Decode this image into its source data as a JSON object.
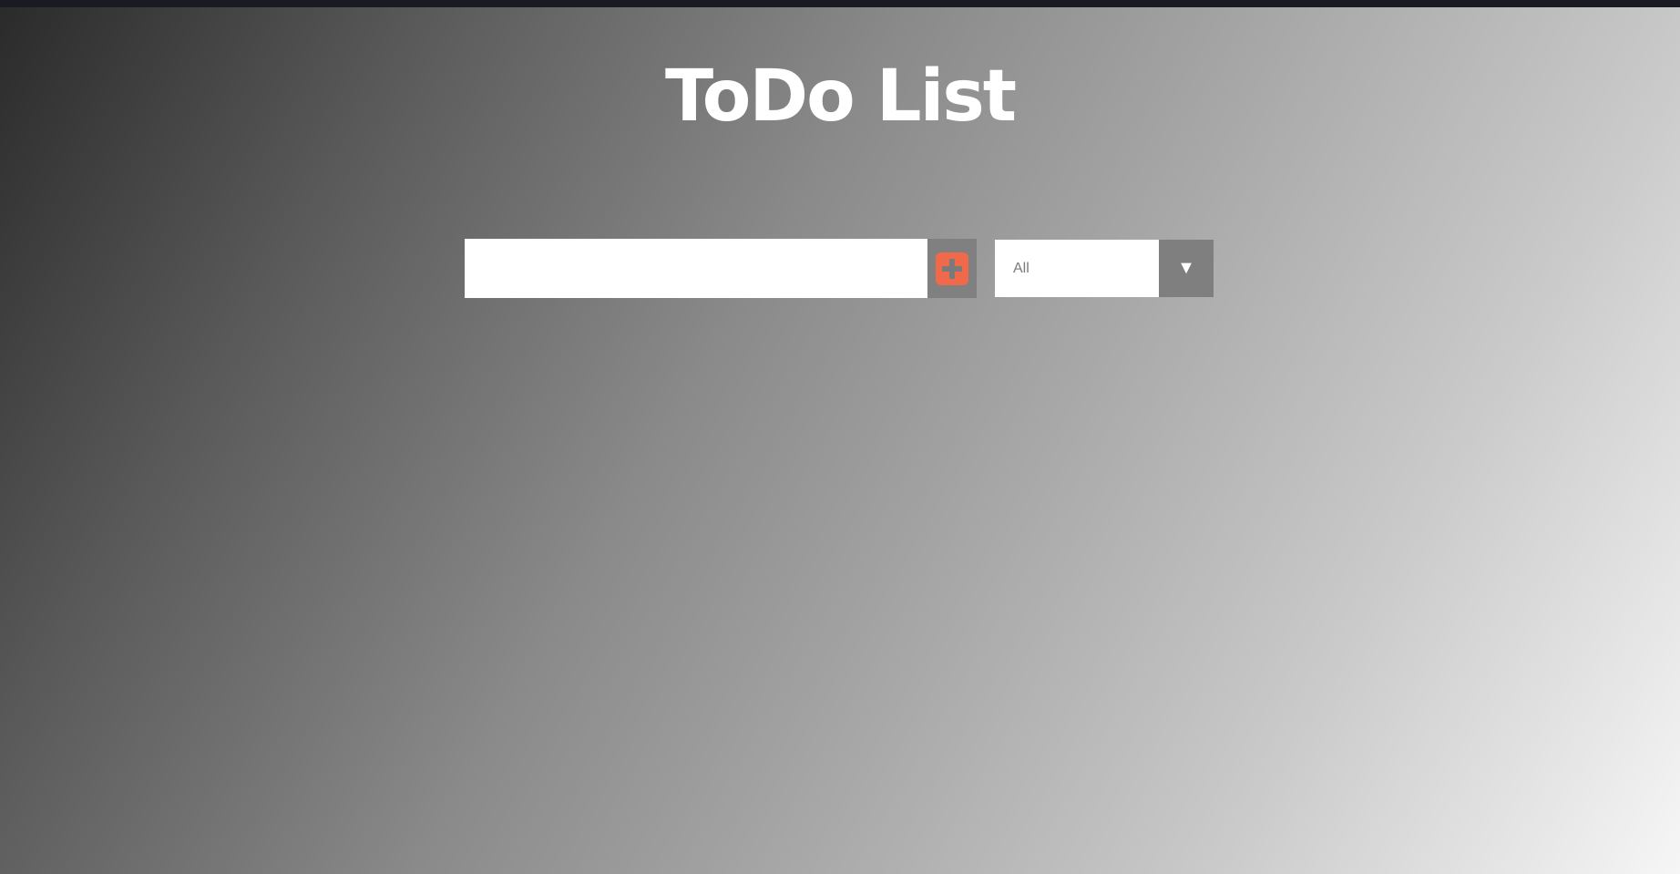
{
  "app": {
    "title": "ToDo List"
  },
  "form": {
    "input_value": "",
    "input_placeholder": "",
    "add_icon": "plus-square-icon"
  },
  "filter": {
    "selected": "All",
    "arrow_glyph": "▼",
    "arrow_icon": "caret-down-icon"
  },
  "colors": {
    "accent": "#f0694a",
    "button_bg": "#808080",
    "title_text": "#ffffff",
    "topbar": "#1a1a22"
  }
}
